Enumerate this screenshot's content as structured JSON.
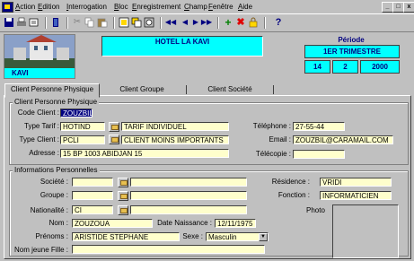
{
  "menu": [
    "Action",
    "Edition",
    "Interrogation",
    "Bloc",
    "Enregistrement",
    "Champ",
    "Fenêtre",
    "Aide"
  ],
  "window_controls": [
    "_",
    "□",
    "x"
  ],
  "toolbar": {
    "help_glyph": "?"
  },
  "header": {
    "logo_text": "KAVI",
    "hotel_name": "HOTEL LA KAVI",
    "periode_label": "Période",
    "periode_value": "1ER TRIMESTRE",
    "periode_num": "14",
    "periode_mois": "2",
    "periode_annee": "2000"
  },
  "tabs": [
    "Client Personne Physique",
    "Client Groupe",
    "Client Société"
  ],
  "group1": {
    "title": "Client Personne Physique",
    "code_label": "Code Client :",
    "code_value": "ZOUZBIL",
    "type_tarif_label": "Type Tarif :",
    "type_tarif_code": "HOTIND",
    "type_tarif_desc": "TARIF INDIVIDUEL",
    "type_client_label": "Type Client :",
    "type_client_code": "PCLI",
    "type_client_desc": "CLIENT MOINS IMPORTANTS",
    "adresse_label": "Adresse :",
    "adresse_value": "15 BP 1003 ABIDJAN 15",
    "telephone_label": "Téléphone :",
    "telephone_value": "27-55-44",
    "email_label": "Email :",
    "email_value": "ZOUZBIL@CARAMAIL.COM",
    "telecopie_label": "Télécopie :",
    "telecopie_value": ""
  },
  "group2": {
    "title": "Informations Personnelles",
    "societe_label": "Société :",
    "societe_code": "",
    "societe_desc": "",
    "groupe_label": "Groupe :",
    "groupe_code": "",
    "groupe_desc": "",
    "nationalite_label": "Nationalité :",
    "nationalite_code": "CI",
    "nationalite_desc": "",
    "nom_label": "Nom :",
    "nom_value": "ZOUZOUA",
    "date_naiss_label": "Date Naissance :",
    "date_naiss_value": "12/11/1975",
    "prenoms_label": "Prénoms :",
    "prenoms_value": "ARISTIDE STEPHANE",
    "sexe_label": "Sexe :",
    "sexe_value": "Masculin",
    "nom_jeune_fille_label": "Nom jeune Fille :",
    "nom_jeune_fille_value": "",
    "residence_label": "Résidence :",
    "residence_value": "VRIDI",
    "fonction_label": "Fonction :",
    "fonction_value": "INFORMATICIEN",
    "photo_label": "Photo"
  },
  "colors": {
    "accent": "#000080",
    "field_bg": "#ffffcc",
    "header_bg": "#00ffff",
    "window_bg": "#c0c0c0"
  }
}
